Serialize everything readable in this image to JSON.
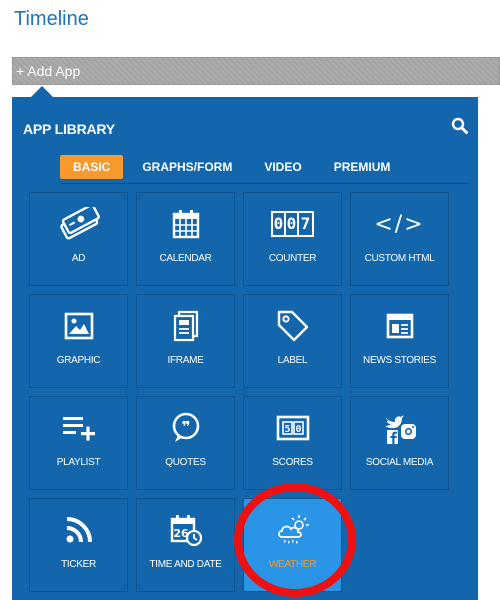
{
  "page": {
    "title": "Timeline"
  },
  "add_app": {
    "label": "+ Add App"
  },
  "library": {
    "title": "APP LIBRARY",
    "search_icon": "search-icon",
    "tabs": [
      {
        "label": "BASIC",
        "active": true
      },
      {
        "label": "GRAPHS/FORM",
        "active": false
      },
      {
        "label": "VIDEO",
        "active": false
      },
      {
        "label": "PREMIUM",
        "active": false
      }
    ],
    "apps": [
      {
        "label": "AD",
        "icon": "ad-ticket-icon"
      },
      {
        "label": "CALENDAR",
        "icon": "calendar-icon"
      },
      {
        "label": "COUNTER",
        "icon": "counter-icon",
        "digits": "007"
      },
      {
        "label": "CUSTOM HTML",
        "icon": "code-icon",
        "glyph": "</>"
      },
      {
        "label": "GRAPHIC",
        "icon": "picture-icon"
      },
      {
        "label": "IFRAME",
        "icon": "iframe-icon"
      },
      {
        "label": "LABEL",
        "icon": "tag-icon"
      },
      {
        "label": "NEWS STORIES",
        "icon": "news-icon"
      },
      {
        "label": "PLAYLIST",
        "icon": "playlist-add-icon"
      },
      {
        "label": "QUOTES",
        "icon": "quote-bubble-icon",
        "glyph": "❞"
      },
      {
        "label": "SCORES",
        "icon": "scoreboard-icon",
        "digits": "5 0"
      },
      {
        "label": "SOCIAL MEDIA",
        "icon": "social-media-icon"
      },
      {
        "label": "TICKER",
        "icon": "rss-icon"
      },
      {
        "label": "TIME AND DATE",
        "icon": "calendar-clock-icon",
        "digits": "26"
      },
      {
        "label": "WEATHER",
        "icon": "cloud-sun-icon",
        "selected": true
      }
    ]
  },
  "colors": {
    "title_blue": "#1e73b9",
    "panel_blue": "#1366ab",
    "selected_tile": "#2a94e6",
    "active_tab": "#f79a2e",
    "highlight_red": "#ee1111"
  }
}
